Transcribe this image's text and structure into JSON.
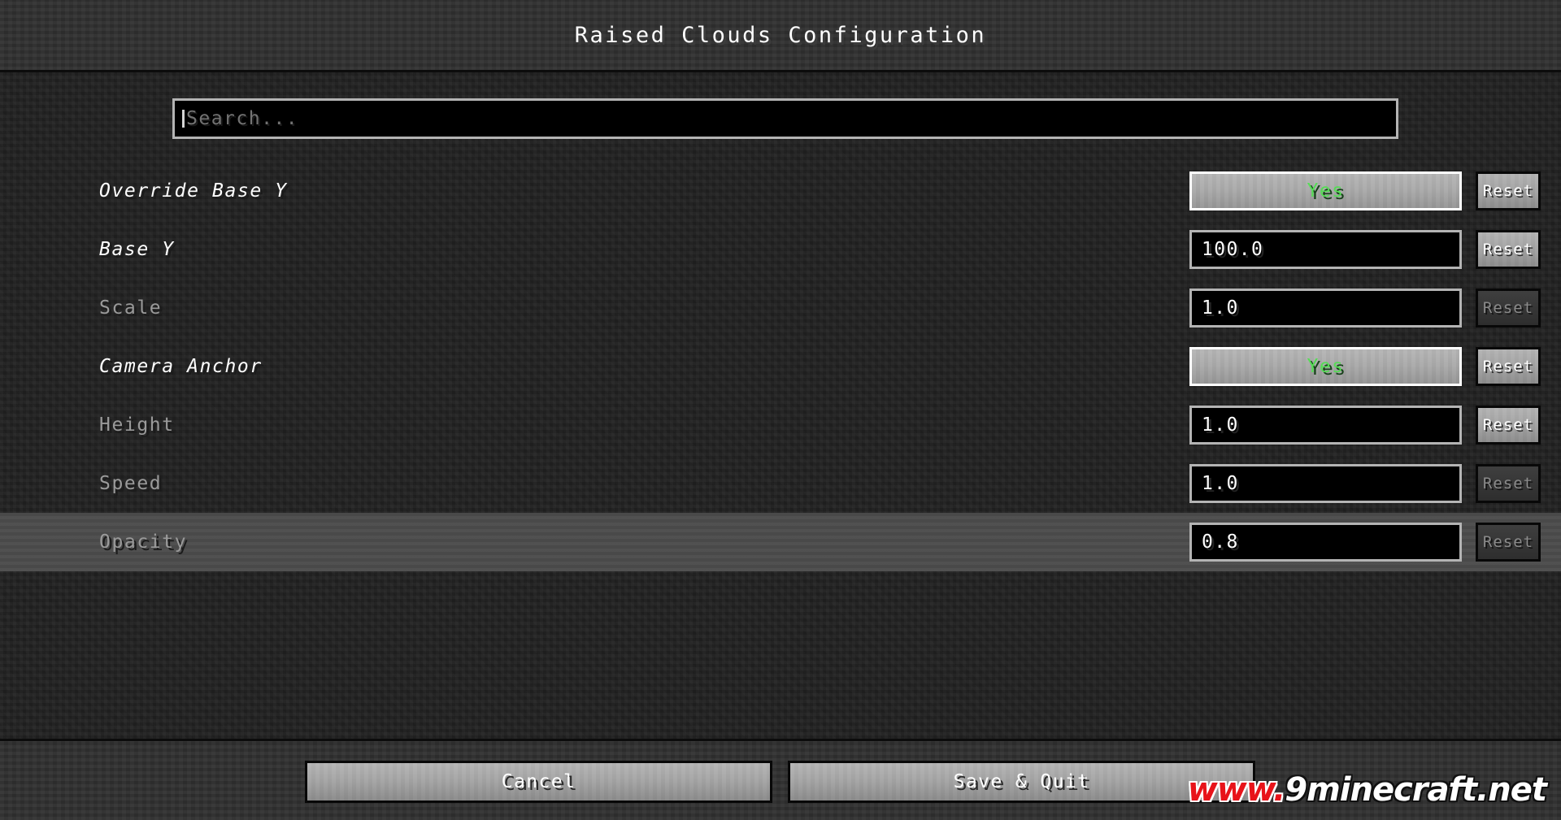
{
  "window": {
    "title": "Raised Clouds Configuration"
  },
  "search": {
    "placeholder": "Search..."
  },
  "colors": {
    "toggle_yes_text": "#55DD55",
    "modified_label": "#FFFFFF",
    "default_label": "#9A9A9A",
    "background": "#1D1D1D",
    "panel": "#2F2F2F",
    "button_face": "#A0A0A0",
    "watermark_red": "#E8131A"
  },
  "rows": [
    {
      "label": "Override Base Y",
      "modified": true,
      "control_type": "toggle",
      "value": "Yes",
      "reset_label": "Reset",
      "reset_enabled": true,
      "highlighted": false
    },
    {
      "label": "Base Y",
      "modified": true,
      "control_type": "text",
      "value": "100.0",
      "reset_label": "Reset",
      "reset_enabled": true,
      "highlighted": false
    },
    {
      "label": "Scale",
      "modified": false,
      "control_type": "text",
      "value": "1.0",
      "reset_label": "Reset",
      "reset_enabled": false,
      "highlighted": false
    },
    {
      "label": "Camera Anchor",
      "modified": true,
      "control_type": "toggle",
      "value": "Yes",
      "reset_label": "Reset",
      "reset_enabled": true,
      "highlighted": false
    },
    {
      "label": "Height",
      "modified": false,
      "control_type": "text",
      "value": "1.0",
      "reset_label": "Reset",
      "reset_enabled": true,
      "highlighted": false
    },
    {
      "label": "Speed",
      "modified": false,
      "control_type": "text",
      "value": "1.0",
      "reset_label": "Reset",
      "reset_enabled": false,
      "highlighted": false
    },
    {
      "label": "Opacity",
      "modified": false,
      "control_type": "text",
      "value": "0.8",
      "reset_label": "Reset",
      "reset_enabled": false,
      "highlighted": true
    }
  ],
  "footer": {
    "cancel_label": "Cancel",
    "save_quit_label": "Save & Quit"
  },
  "watermark": {
    "prefix": "www.",
    "suffix": "9minecraft.net"
  }
}
